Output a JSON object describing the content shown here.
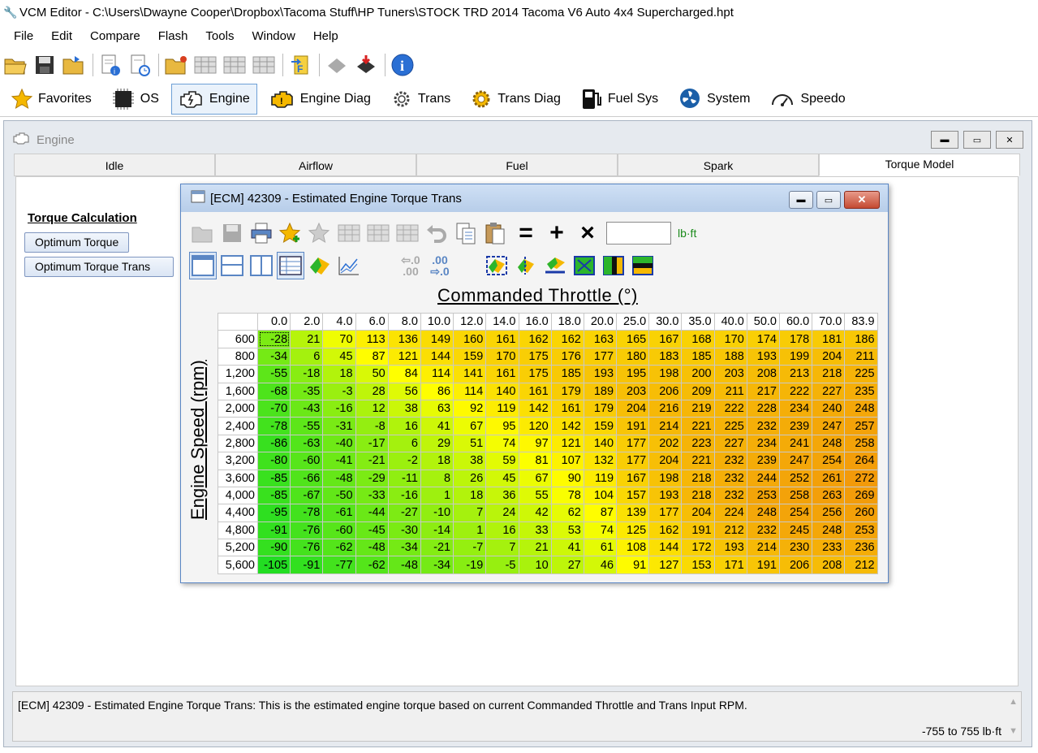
{
  "window": {
    "title": "VCM Editor - C:\\Users\\Dwayne Cooper\\Dropbox\\Tacoma Stuff\\HP Tuners\\STOCK TRD 2014 Tacoma V6 Auto 4x4 Supercharged.hpt"
  },
  "menu": [
    "File",
    "Edit",
    "Compare",
    "Flash",
    "Tools",
    "Window",
    "Help"
  ],
  "nav": [
    {
      "label": "Favorites",
      "icon": "star-icon"
    },
    {
      "label": "OS",
      "icon": "chip-icon"
    },
    {
      "label": "Engine",
      "icon": "engine-icon",
      "active": true
    },
    {
      "label": "Engine Diag",
      "icon": "engine-diag-icon"
    },
    {
      "label": "Trans",
      "icon": "gear-icon"
    },
    {
      "label": "Trans Diag",
      "icon": "gear-diag-icon"
    },
    {
      "label": "Fuel Sys",
      "icon": "fuel-pump-icon"
    },
    {
      "label": "System",
      "icon": "fan-icon"
    },
    {
      "label": "Speedo",
      "icon": "speedometer-icon"
    }
  ],
  "engine_window": {
    "title": "Engine",
    "tabs": [
      "Idle",
      "Airflow",
      "Fuel",
      "Spark",
      "Torque Model"
    ],
    "active_tab": "Torque Model",
    "calc_title": "Torque Calculation",
    "calc_buttons": [
      "Optimum Torque",
      "Optimum Torque Trans"
    ],
    "description": "[ECM] 42309 - Estimated Engine Torque Trans: This is the estimated engine torque based on current Commanded Throttle and Trans Input RPM.",
    "range": "-755 to 755 lb·ft"
  },
  "table_window": {
    "title": "[ECM] 42309 - Estimated Engine Torque Trans",
    "unit": "lb·ft",
    "x_label": "Commanded Throttle (°)",
    "y_label": "Engine Speed (rpm)",
    "decimals_inc": "⇦.0 .00",
    "decimals_dec": ".00 ⇨.0",
    "columns": [
      "0.0",
      "2.0",
      "4.0",
      "6.0",
      "8.0",
      "10.0",
      "12.0",
      "14.0",
      "16.0",
      "18.0",
      "20.0",
      "25.0",
      "30.0",
      "35.0",
      "40.0",
      "50.0",
      "60.0",
      "70.0",
      "83.9"
    ],
    "rows": [
      "600",
      "800",
      "1,200",
      "1,600",
      "2,000",
      "2,400",
      "2,800",
      "3,200",
      "3,600",
      "4,000",
      "4,400",
      "4,800",
      "5,200",
      "5,600"
    ],
    "values": [
      [
        -28,
        21,
        70,
        113,
        136,
        149,
        160,
        161,
        162,
        162,
        163,
        165,
        167,
        168,
        170,
        174,
        178,
        181,
        186
      ],
      [
        -34,
        6,
        45,
        87,
        121,
        144,
        159,
        170,
        175,
        176,
        177,
        180,
        183,
        185,
        188,
        193,
        199,
        204,
        211
      ],
      [
        -55,
        -18,
        18,
        50,
        84,
        114,
        141,
        161,
        175,
        185,
        193,
        195,
        198,
        200,
        203,
        208,
        213,
        218,
        225
      ],
      [
        -68,
        -35,
        -3,
        28,
        56,
        86,
        114,
        140,
        161,
        179,
        189,
        203,
        206,
        209,
        211,
        217,
        222,
        227,
        235
      ],
      [
        -70,
        -43,
        -16,
        12,
        38,
        63,
        92,
        119,
        142,
        161,
        179,
        204,
        216,
        219,
        222,
        228,
        234,
        240,
        248
      ],
      [
        -78,
        -55,
        -31,
        -8,
        16,
        41,
        67,
        95,
        120,
        142,
        159,
        191,
        214,
        221,
        225,
        232,
        239,
        247,
        257
      ],
      [
        -86,
        -63,
        -40,
        -17,
        6,
        29,
        51,
        74,
        97,
        121,
        140,
        177,
        202,
        223,
        227,
        234,
        241,
        248,
        258
      ],
      [
        -80,
        -60,
        -41,
        -21,
        -2,
        18,
        38,
        59,
        81,
        107,
        132,
        177,
        204,
        221,
        232,
        239,
        247,
        254,
        264
      ],
      [
        -85,
        -66,
        -48,
        -29,
        -11,
        8,
        26,
        45,
        67,
        90,
        119,
        167,
        198,
        218,
        232,
        244,
        252,
        261,
        272
      ],
      [
        -85,
        -67,
        -50,
        -33,
        -16,
        1,
        18,
        36,
        55,
        78,
        104,
        157,
        193,
        218,
        232,
        253,
        258,
        263,
        269
      ],
      [
        -95,
        -78,
        -61,
        -44,
        -27,
        -10,
        7,
        24,
        42,
        62,
        87,
        139,
        177,
        204,
        224,
        248,
        254,
        256,
        260
      ],
      [
        -91,
        -76,
        -60,
        -45,
        -30,
        -14,
        1,
        16,
        33,
        53,
        74,
        125,
        162,
        191,
        212,
        232,
        245,
        248,
        253
      ],
      [
        -90,
        -76,
        -62,
        -48,
        -34,
        -21,
        -7,
        7,
        21,
        41,
        61,
        108,
        144,
        172,
        193,
        214,
        230,
        233,
        236
      ],
      [
        -105,
        -91,
        -77,
        -62,
        -48,
        -34,
        -19,
        -5,
        10,
        27,
        46,
        91,
        127,
        153,
        171,
        191,
        206,
        208,
        212
      ]
    ],
    "selected_cell": "600 rpm / 0.0",
    "colors": {
      "low": "#22dd22",
      "mid": "#ffff00",
      "high": "#f29a0a"
    }
  }
}
